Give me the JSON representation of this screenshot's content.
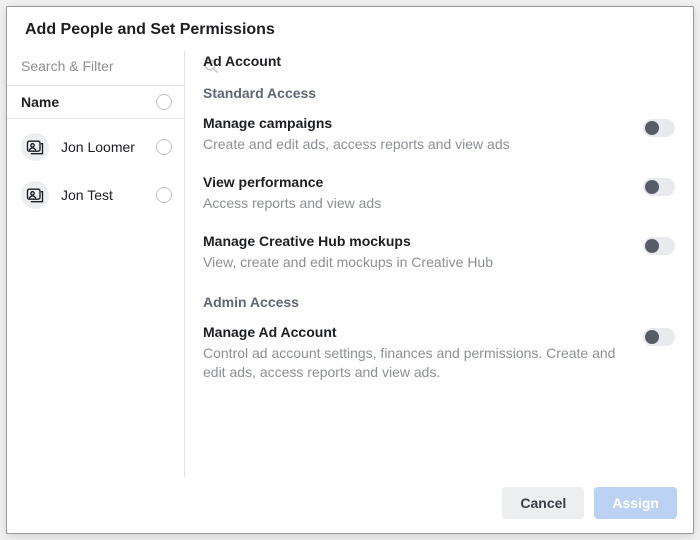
{
  "title": "Add People and Set Permissions",
  "search": {
    "placeholder": "Search & Filter"
  },
  "name_header": "Name",
  "people": [
    {
      "name": "Jon Loomer"
    },
    {
      "name": "Jon Test"
    }
  ],
  "right": {
    "section": "Ad Account",
    "standard_label": "Standard Access",
    "admin_label": "Admin Access",
    "permissions": {
      "manage_campaigns": {
        "title": "Manage campaigns",
        "desc": "Create and edit ads, access reports and view ads"
      },
      "view_performance": {
        "title": "View performance",
        "desc": "Access reports and view ads"
      },
      "creative_hub": {
        "title": "Manage Creative Hub mockups",
        "desc": "View, create and edit mockups in Creative Hub"
      },
      "manage_account": {
        "title": "Manage Ad Account",
        "desc": "Control ad account settings, finances and permissions. Create and edit ads, access reports and view ads."
      }
    }
  },
  "buttons": {
    "cancel": "Cancel",
    "assign": "Assign"
  }
}
